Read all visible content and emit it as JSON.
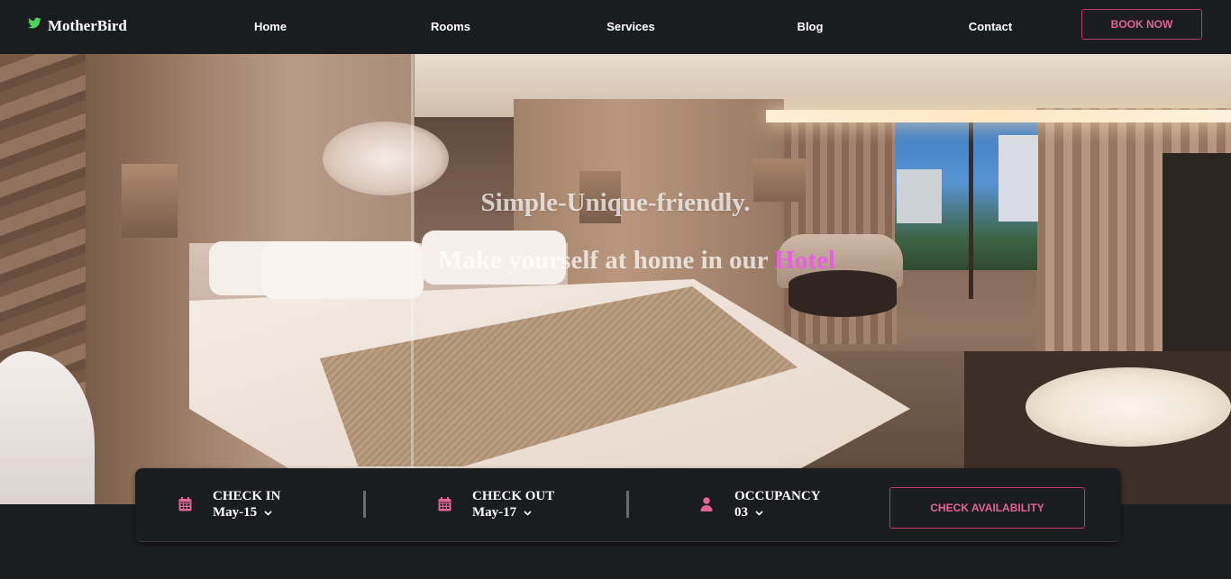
{
  "brand": {
    "name": "MotherBird",
    "icon": "twitter-bird-icon",
    "icon_color": "#4fd15a"
  },
  "nav": {
    "links": [
      "Home",
      "Rooms",
      "Services",
      "Blog",
      "Contact"
    ],
    "cta": "BOOK NOW"
  },
  "hero": {
    "tagline": "Simple-Unique-friendly.",
    "headline_prefix": "Make yourself at home in our ",
    "headline_accent": "Hotel"
  },
  "booking": {
    "check_in": {
      "label": "CHECK IN",
      "value": "May-15",
      "icon": "calendar-icon"
    },
    "check_out": {
      "label": "CHECK OUT",
      "value": "May-17",
      "icon": "calendar-icon"
    },
    "occupancy": {
      "label": "OCCUPANCY",
      "value": "03",
      "icon": "person-icon"
    },
    "button": "CHECK AVAILABILITY"
  },
  "colors": {
    "accent": "#e26592",
    "highlight": "#ea5ee0",
    "background": "#1c1d21"
  }
}
